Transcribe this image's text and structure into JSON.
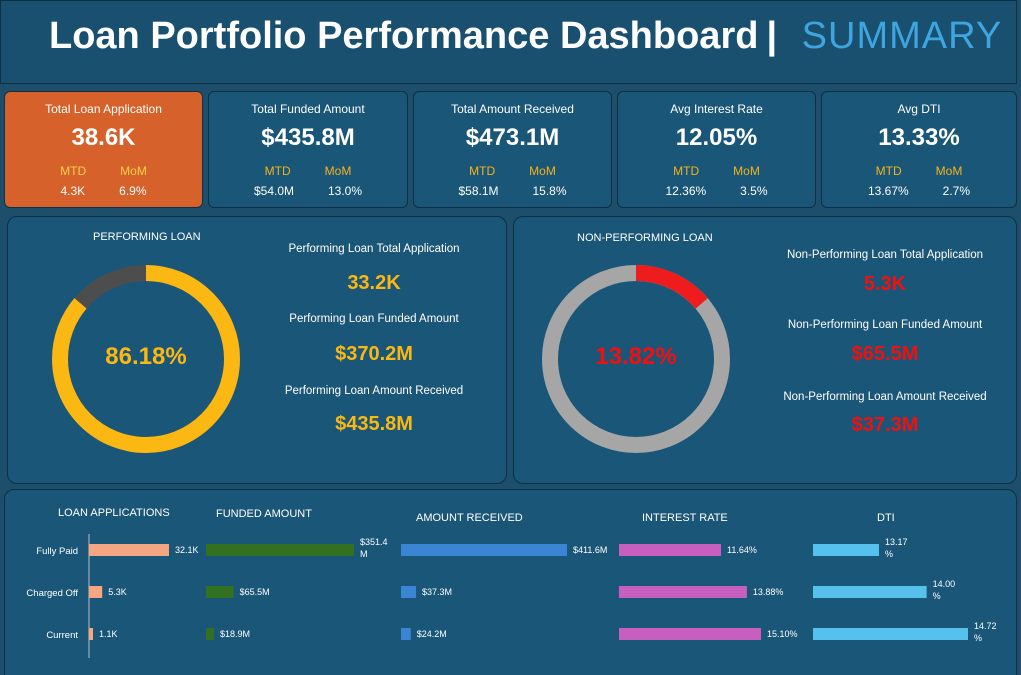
{
  "header": {
    "title": "Loan Portfolio Performance Dashboard",
    "separator": "|",
    "subtitle": "SUMMARY"
  },
  "kpis": [
    {
      "label": "Total Loan Application",
      "value": "38.6K",
      "mtd_label": "MTD",
      "mom_label": "MoM",
      "mtd": "4.3K",
      "mom": "6.9%"
    },
    {
      "label": "Total Funded Amount",
      "value": "$435.8M",
      "mtd_label": "MTD",
      "mom_label": "MoM",
      "mtd": "$54.0M",
      "mom": "13.0%"
    },
    {
      "label": "Total Amount Received",
      "value": "$473.1M",
      "mtd_label": "MTD",
      "mom_label": "MoM",
      "mtd": "$58.1M",
      "mom": "15.8%"
    },
    {
      "label": "Avg Interest Rate",
      "value": "12.05%",
      "mtd_label": "MTD",
      "mom_label": "MoM",
      "mtd": "12.36%",
      "mom": "3.5%"
    },
    {
      "label": "Avg DTI",
      "value": "13.33%",
      "mtd_label": "MTD",
      "mom_label": "MoM",
      "mtd": "13.67%",
      "mom": "2.7%"
    }
  ],
  "performing": {
    "title": "PERFORMING LOAN",
    "percent_label": "86.18%",
    "percent": 86.18,
    "ring_color": "#fbb813",
    "rest_color": "#4d4d4d",
    "app_label": "Performing Loan Total Application",
    "app_value": "33.2K",
    "funded_label": "Performing Loan Funded Amount",
    "funded_value": "$370.2M",
    "received_label": "Performing Loan Amount Received",
    "received_value": "$435.8M"
  },
  "non_performing": {
    "title": "NON-PERFORMING LOAN",
    "percent_label": "13.82%",
    "percent": 13.82,
    "ring_color": "#ee1c1c",
    "rest_color": "#a6a6a6",
    "app_label": "Non-Performing Loan Total Application",
    "app_value": "5.3K",
    "funded_label": "Non-Performing Loan Funded Amount",
    "funded_value": "$65.5M",
    "received_label": "Non-Performing Loan Amount Received",
    "received_value": "$37.3M"
  },
  "chart_data": [
    {
      "type": "bar",
      "orientation": "horizontal",
      "title": "LOAN APPLICATIONS",
      "categories": [
        "Fully Paid",
        "Charged Off",
        "Current"
      ],
      "values": [
        32.1,
        5.3,
        1.1
      ],
      "unit": "K",
      "labels": [
        "32.1K",
        "5.3K",
        "1.1K"
      ],
      "color": "#f4a582"
    },
    {
      "type": "bar",
      "orientation": "horizontal",
      "title": "FUNDED AMOUNT",
      "categories": [
        "Fully Paid",
        "Charged Off",
        "Current"
      ],
      "values": [
        351.4,
        65.5,
        18.9
      ],
      "unit": "M",
      "labels": [
        "$351.4 M",
        "$65.5M",
        "$18.9M"
      ],
      "color": "#33701f"
    },
    {
      "type": "bar",
      "orientation": "horizontal",
      "title": "AMOUNT RECEIVED",
      "categories": [
        "Fully Paid",
        "Charged Off",
        "Current"
      ],
      "values": [
        411.6,
        37.3,
        24.2
      ],
      "unit": "M",
      "labels": [
        "$411.6M",
        "$37.3M",
        "$24.2M"
      ],
      "color": "#3a85d4"
    },
    {
      "type": "bar",
      "orientation": "horizontal",
      "title": "INTEREST RATE",
      "categories": [
        "Fully Paid",
        "Charged Off",
        "Current"
      ],
      "values": [
        11.64,
        13.88,
        15.1
      ],
      "unit": "%",
      "labels": [
        "11.64%",
        "13.88%",
        "15.10%"
      ],
      "color": "#c75fc1"
    },
    {
      "type": "bar",
      "orientation": "horizontal",
      "title": "DTI",
      "categories": [
        "Fully Paid",
        "Charged Off",
        "Current"
      ],
      "values": [
        13.17,
        14.0,
        14.72
      ],
      "unit": "%",
      "labels": [
        "13.17 %",
        "14.00 %",
        "14.72 %"
      ],
      "color": "#57c1ee"
    }
  ]
}
